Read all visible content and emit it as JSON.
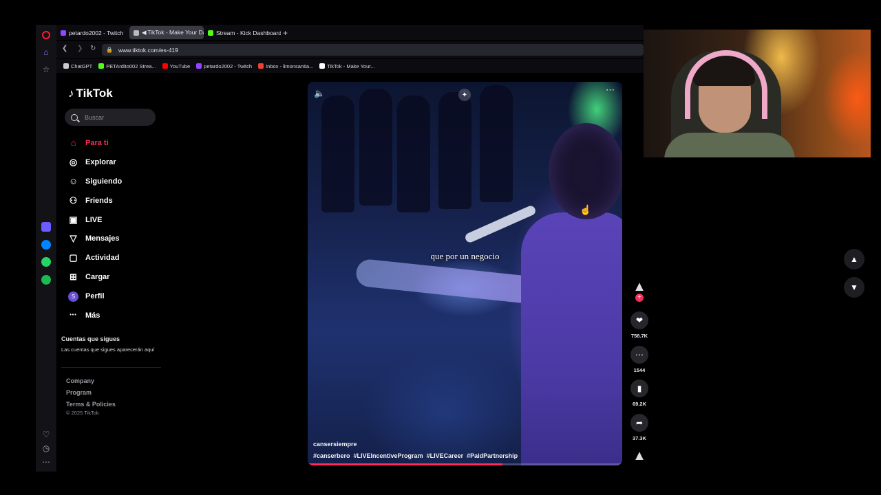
{
  "browser": {
    "tabs": [
      {
        "label": "petardo2002 - Twitch",
        "color": "#9146ff"
      },
      {
        "label": "◀ TikTok - Make Your Da",
        "color": "#bbbbbb"
      },
      {
        "label": "Stream - Kick Dashboard",
        "color": "#53fc18"
      }
    ],
    "new_tab_label": "+",
    "url": "www.tiktok.com/es-419",
    "bookmarks": [
      {
        "label": "ChatGPT",
        "color": "#cccccc"
      },
      {
        "label": "PETArdito002 Strea...",
        "color": "#53fc18"
      },
      {
        "label": "YouTube",
        "color": "#ff0000"
      },
      {
        "label": "petardo2002 - Twitch",
        "color": "#9146ff"
      },
      {
        "label": "Inbox - limonsantia...",
        "color": "#ea4335"
      },
      {
        "label": "TikTok - Make Your...",
        "color": "#ffffff"
      }
    ]
  },
  "tiktok": {
    "logo": "TikTok",
    "search_placeholder": "Buscar",
    "nav": [
      {
        "label": "Para ti",
        "icon": "home-icon",
        "glyph": "⌂"
      },
      {
        "label": "Explorar",
        "icon": "compass-icon",
        "glyph": "◎"
      },
      {
        "label": "Siguiendo",
        "icon": "user-follow-icon",
        "glyph": "☺"
      },
      {
        "label": "Friends",
        "icon": "friends-icon",
        "glyph": "⚇"
      },
      {
        "label": "LIVE",
        "icon": "live-tv-icon",
        "glyph": "▣"
      },
      {
        "label": "Mensajes",
        "icon": "send-icon",
        "glyph": "▽"
      },
      {
        "label": "Actividad",
        "icon": "activity-icon",
        "glyph": "▢"
      },
      {
        "label": "Cargar",
        "icon": "upload-icon",
        "glyph": "⊞"
      },
      {
        "label": "Perfil",
        "icon": "profile-avatar-icon",
        "glyph": "S"
      },
      {
        "label": "Más",
        "icon": "more-icon",
        "glyph": "•••"
      }
    ],
    "following_heading": "Cuentas que sigues",
    "following_text": "Las cuentas que sigues aparecerán aquí",
    "footer_links": [
      "Company",
      "Program",
      "Terms & Policies"
    ],
    "copyright": "© 2025 TikTok",
    "video": {
      "caption": "que por un negocio",
      "author": "cansersiempre",
      "hashtags": [
        "#canserbero",
        "#LIVEIncentiveProgram",
        "#LIVECareer",
        "#PaidPartnership"
      ],
      "progress_percent": 62,
      "likes": "758.7K",
      "comments": "1544",
      "saves": "69.2K",
      "shares": "37.3K"
    },
    "accent": "#fe2c55"
  }
}
